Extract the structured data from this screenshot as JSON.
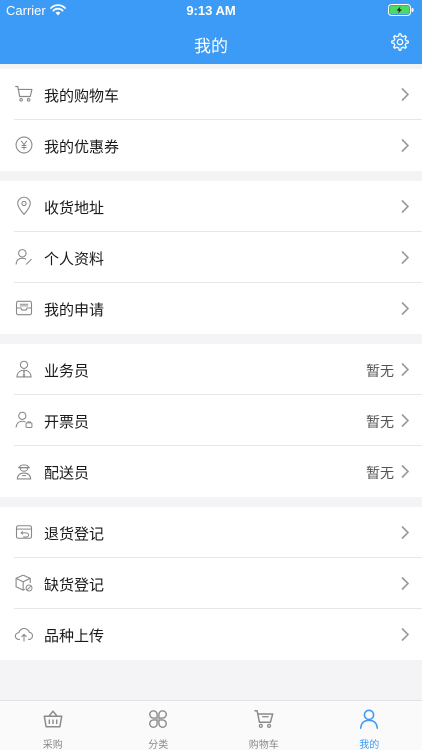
{
  "status_bar": {
    "carrier": "Carrier",
    "time": "9:13 AM"
  },
  "header": {
    "title": "我的",
    "background_color": "#3b9bf6"
  },
  "menu_groups": [
    {
      "items": [
        {
          "label": "我的购物车",
          "icon": "shopping-cart-icon"
        },
        {
          "label": "我的优惠券",
          "icon": "coupon-icon"
        }
      ]
    },
    {
      "items": [
        {
          "label": "收货地址",
          "icon": "location-pin-icon"
        },
        {
          "label": "个人资料",
          "icon": "user-profile-icon"
        },
        {
          "label": "我的申请",
          "icon": "inbox-icon"
        }
      ]
    },
    {
      "items": [
        {
          "label": "业务员",
          "value": "暂无",
          "icon": "salesperson-icon"
        },
        {
          "label": "开票员",
          "value": "暂无",
          "icon": "invoice-clerk-icon"
        },
        {
          "label": "配送员",
          "value": "暂无",
          "icon": "delivery-person-icon"
        }
      ]
    },
    {
      "items": [
        {
          "label": "退货登记",
          "icon": "return-box-icon"
        },
        {
          "label": "缺货登记",
          "icon": "out-of-stock-icon"
        },
        {
          "label": "品种上传",
          "icon": "cloud-upload-icon"
        }
      ]
    }
  ],
  "tab_bar": {
    "active_color": "#3b9bf6",
    "tabs": [
      {
        "label": "采购",
        "icon": "basket-icon",
        "active": false
      },
      {
        "label": "分类",
        "icon": "category-grid-icon",
        "active": false
      },
      {
        "label": "购物车",
        "icon": "cart-icon",
        "active": false
      },
      {
        "label": "我的",
        "icon": "person-icon",
        "active": true
      }
    ]
  }
}
